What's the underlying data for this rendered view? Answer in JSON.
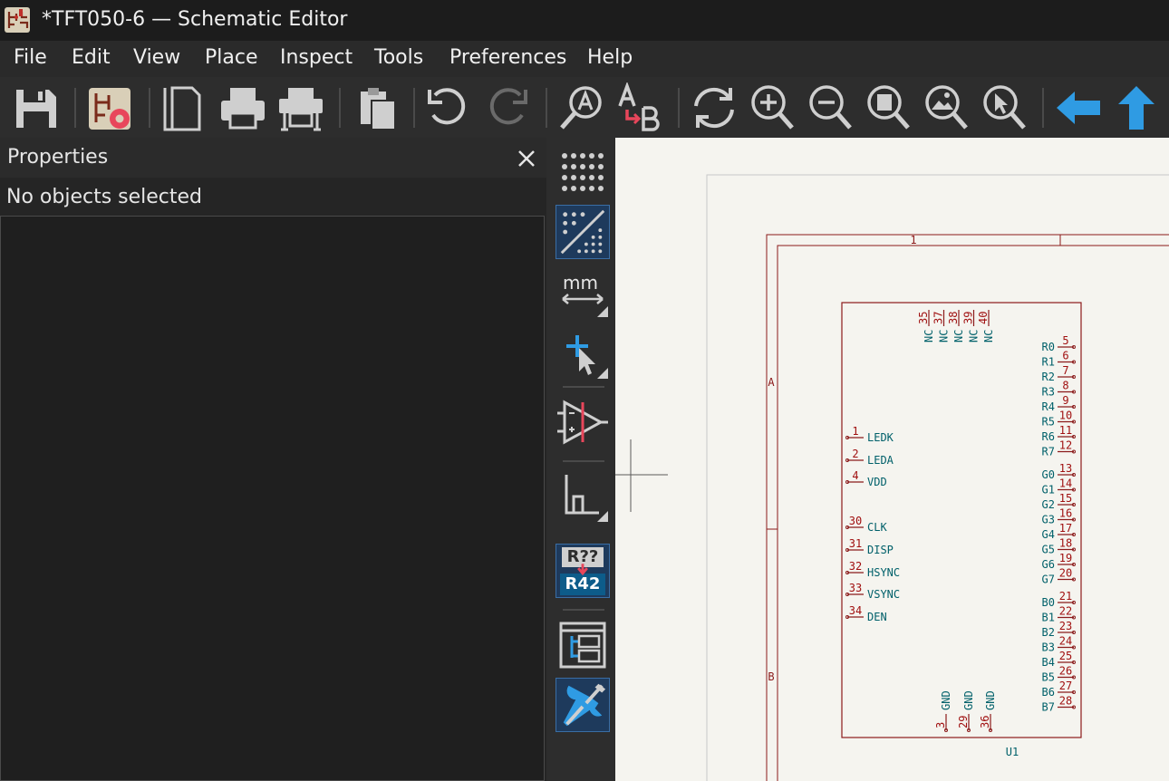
{
  "window": {
    "title": "*TFT050-6 — Schematic Editor"
  },
  "menu": [
    "File",
    "Edit",
    "View",
    "Place",
    "Inspect",
    "Tools",
    "Preferences",
    "Help"
  ],
  "toolbar": {
    "buttons": [
      "save-icon",
      "schematic-setup-icon",
      "page-settings-icon",
      "print-icon",
      "plot-icon",
      "paste-icon",
      "undo-icon",
      "redo-icon",
      "find-icon",
      "find-replace-icon",
      "refresh-icon",
      "zoom-in-icon",
      "zoom-out-icon",
      "zoom-fit-icon",
      "zoom-objects-icon",
      "zoom-selection-icon",
      "navigate-back-icon",
      "navigate-up-icon"
    ]
  },
  "properties": {
    "title": "Properties",
    "status": "No objects selected"
  },
  "left_toolbar": {
    "units_label": "mm",
    "annotate_top": "R??",
    "annotate_bottom": "R42"
  },
  "schematic": {
    "frame": {
      "col1": "1",
      "row_a": "A",
      "row_b": "B"
    },
    "reference": "U1",
    "top_pins": [
      {
        "name": "NC",
        "num": "35"
      },
      {
        "name": "NC",
        "num": "37"
      },
      {
        "name": "NC",
        "num": "38"
      },
      {
        "name": "NC",
        "num": "39"
      },
      {
        "name": "NC",
        "num": "40"
      }
    ],
    "bottom_pins": [
      {
        "name": "GND",
        "num": "3"
      },
      {
        "name": "GND",
        "num": "29"
      },
      {
        "name": "GND",
        "num": "36"
      }
    ],
    "left_pins": [
      {
        "name": "LEDK",
        "num": "1"
      },
      {
        "name": "LEDA",
        "num": "2"
      },
      {
        "name": "VDD",
        "num": "4"
      },
      {
        "name": "CLK",
        "num": "30"
      },
      {
        "name": "DISP",
        "num": "31"
      },
      {
        "name": "HSYNC",
        "num": "32"
      },
      {
        "name": "VSYNC",
        "num": "33"
      },
      {
        "name": "DEN",
        "num": "34"
      }
    ],
    "right_pins": [
      {
        "name": "R0",
        "num": "5"
      },
      {
        "name": "R1",
        "num": "6"
      },
      {
        "name": "R2",
        "num": "7"
      },
      {
        "name": "R3",
        "num": "8"
      },
      {
        "name": "R4",
        "num": "9"
      },
      {
        "name": "R5",
        "num": "10"
      },
      {
        "name": "R6",
        "num": "11"
      },
      {
        "name": "R7",
        "num": "12"
      },
      {
        "name": "G0",
        "num": "13"
      },
      {
        "name": "G1",
        "num": "14"
      },
      {
        "name": "G2",
        "num": "15"
      },
      {
        "name": "G3",
        "num": "16"
      },
      {
        "name": "G4",
        "num": "17"
      },
      {
        "name": "G5",
        "num": "18"
      },
      {
        "name": "G6",
        "num": "19"
      },
      {
        "name": "G7",
        "num": "20"
      },
      {
        "name": "B0",
        "num": "21"
      },
      {
        "name": "B1",
        "num": "22"
      },
      {
        "name": "B2",
        "num": "23"
      },
      {
        "name": "B3",
        "num": "24"
      },
      {
        "name": "B4",
        "num": "25"
      },
      {
        "name": "B5",
        "num": "26"
      },
      {
        "name": "B6",
        "num": "27"
      },
      {
        "name": "B7",
        "num": "28"
      }
    ]
  },
  "colors": {
    "accent_blue": "#2f9be3",
    "symbol_outline": "#8b1a1a",
    "pin_label": "#00606a",
    "canvas_bg": "#f5f4ef"
  }
}
